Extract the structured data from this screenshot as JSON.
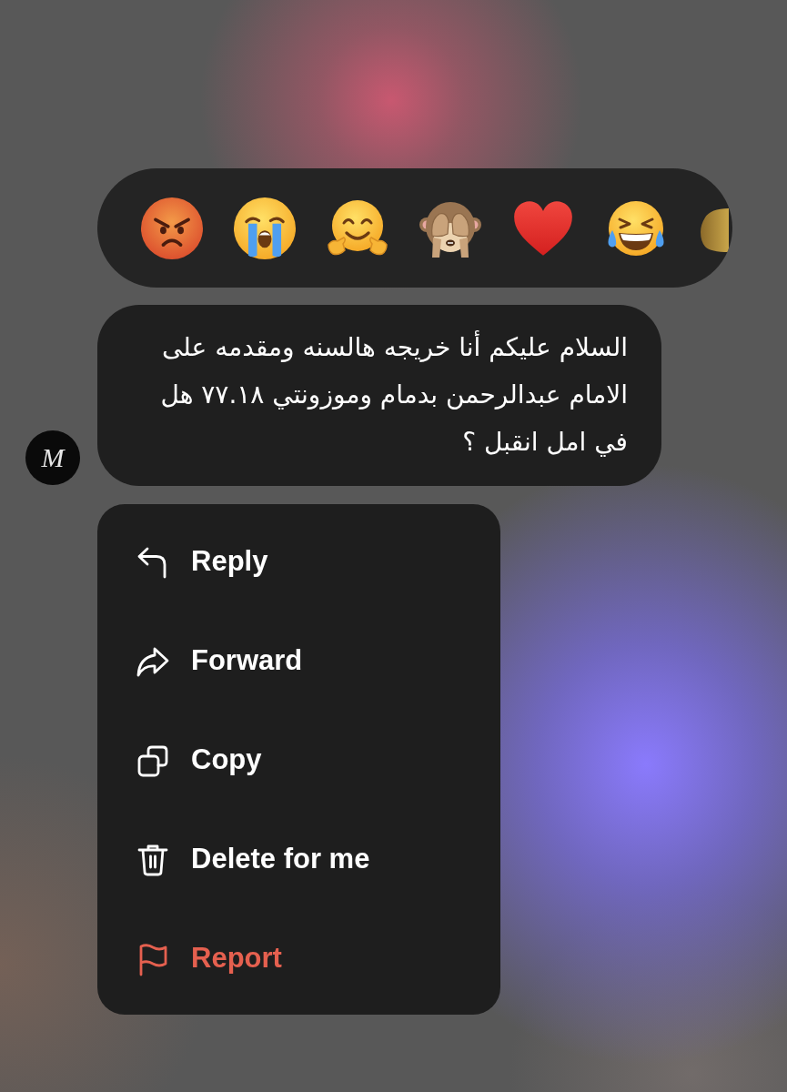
{
  "reactions": [
    {
      "kind": "angry"
    },
    {
      "kind": "crying"
    },
    {
      "kind": "hugging"
    },
    {
      "kind": "see_no_evil"
    },
    {
      "kind": "heart"
    },
    {
      "kind": "laughing"
    },
    {
      "kind": "cut_off"
    }
  ],
  "message": {
    "avatar": {
      "monogram": "M"
    },
    "text": "السلام عليكم أنا خريجه هالسنه ومقدمه على الامام عبدالرحمن بدمام وموزونتي ٧٧.١٨ هل في امل انقبل ؟"
  },
  "menu": [
    {
      "label": "Reply",
      "kind": "default"
    },
    {
      "label": "Forward",
      "kind": "default"
    },
    {
      "label": "Copy",
      "kind": "default"
    },
    {
      "label": "Delete for me",
      "kind": "default"
    },
    {
      "label": "Report",
      "kind": "destructive"
    }
  ]
}
